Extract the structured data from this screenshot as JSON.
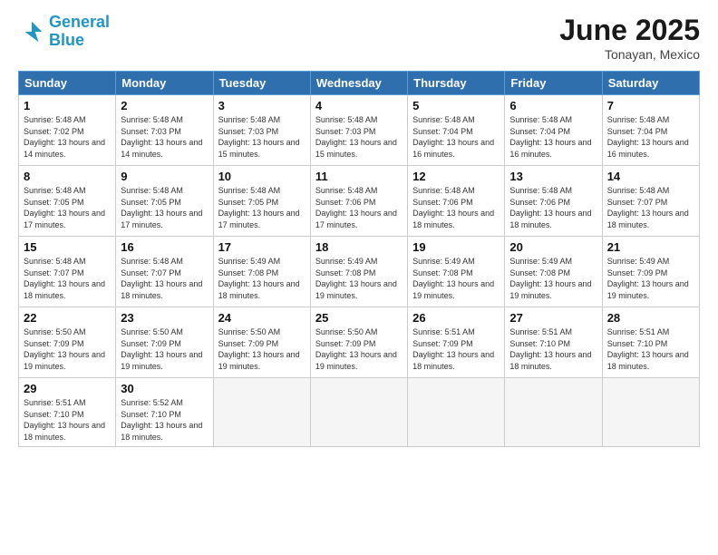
{
  "logo": {
    "line1": "General",
    "line2": "Blue"
  },
  "title": "June 2025",
  "subtitle": "Tonayan, Mexico",
  "weekdays": [
    "Sunday",
    "Monday",
    "Tuesday",
    "Wednesday",
    "Thursday",
    "Friday",
    "Saturday"
  ],
  "days": [
    {
      "num": "",
      "info": ""
    },
    {
      "num": "",
      "info": ""
    },
    {
      "num": "",
      "info": ""
    },
    {
      "num": "",
      "info": ""
    },
    {
      "num": "",
      "info": ""
    },
    {
      "num": "",
      "info": ""
    },
    {
      "num": "",
      "info": ""
    },
    {
      "num": "1",
      "sunrise": "Sunrise: 5:48 AM",
      "sunset": "Sunset: 7:02 PM",
      "daylight": "Daylight: 13 hours and 14 minutes."
    },
    {
      "num": "2",
      "sunrise": "Sunrise: 5:48 AM",
      "sunset": "Sunset: 7:03 PM",
      "daylight": "Daylight: 13 hours and 14 minutes."
    },
    {
      "num": "3",
      "sunrise": "Sunrise: 5:48 AM",
      "sunset": "Sunset: 7:03 PM",
      "daylight": "Daylight: 13 hours and 15 minutes."
    },
    {
      "num": "4",
      "sunrise": "Sunrise: 5:48 AM",
      "sunset": "Sunset: 7:03 PM",
      "daylight": "Daylight: 13 hours and 15 minutes."
    },
    {
      "num": "5",
      "sunrise": "Sunrise: 5:48 AM",
      "sunset": "Sunset: 7:04 PM",
      "daylight": "Daylight: 13 hours and 16 minutes."
    },
    {
      "num": "6",
      "sunrise": "Sunrise: 5:48 AM",
      "sunset": "Sunset: 7:04 PM",
      "daylight": "Daylight: 13 hours and 16 minutes."
    },
    {
      "num": "7",
      "sunrise": "Sunrise: 5:48 AM",
      "sunset": "Sunset: 7:04 PM",
      "daylight": "Daylight: 13 hours and 16 minutes."
    },
    {
      "num": "8",
      "sunrise": "Sunrise: 5:48 AM",
      "sunset": "Sunset: 7:05 PM",
      "daylight": "Daylight: 13 hours and 17 minutes."
    },
    {
      "num": "9",
      "sunrise": "Sunrise: 5:48 AM",
      "sunset": "Sunset: 7:05 PM",
      "daylight": "Daylight: 13 hours and 17 minutes."
    },
    {
      "num": "10",
      "sunrise": "Sunrise: 5:48 AM",
      "sunset": "Sunset: 7:05 PM",
      "daylight": "Daylight: 13 hours and 17 minutes."
    },
    {
      "num": "11",
      "sunrise": "Sunrise: 5:48 AM",
      "sunset": "Sunset: 7:06 PM",
      "daylight": "Daylight: 13 hours and 17 minutes."
    },
    {
      "num": "12",
      "sunrise": "Sunrise: 5:48 AM",
      "sunset": "Sunset: 7:06 PM",
      "daylight": "Daylight: 13 hours and 18 minutes."
    },
    {
      "num": "13",
      "sunrise": "Sunrise: 5:48 AM",
      "sunset": "Sunset: 7:06 PM",
      "daylight": "Daylight: 13 hours and 18 minutes."
    },
    {
      "num": "14",
      "sunrise": "Sunrise: 5:48 AM",
      "sunset": "Sunset: 7:07 PM",
      "daylight": "Daylight: 13 hours and 18 minutes."
    },
    {
      "num": "15",
      "sunrise": "Sunrise: 5:48 AM",
      "sunset": "Sunset: 7:07 PM",
      "daylight": "Daylight: 13 hours and 18 minutes."
    },
    {
      "num": "16",
      "sunrise": "Sunrise: 5:48 AM",
      "sunset": "Sunset: 7:07 PM",
      "daylight": "Daylight: 13 hours and 18 minutes."
    },
    {
      "num": "17",
      "sunrise": "Sunrise: 5:49 AM",
      "sunset": "Sunset: 7:08 PM",
      "daylight": "Daylight: 13 hours and 18 minutes."
    },
    {
      "num": "18",
      "sunrise": "Sunrise: 5:49 AM",
      "sunset": "Sunset: 7:08 PM",
      "daylight": "Daylight: 13 hours and 19 minutes."
    },
    {
      "num": "19",
      "sunrise": "Sunrise: 5:49 AM",
      "sunset": "Sunset: 7:08 PM",
      "daylight": "Daylight: 13 hours and 19 minutes."
    },
    {
      "num": "20",
      "sunrise": "Sunrise: 5:49 AM",
      "sunset": "Sunset: 7:08 PM",
      "daylight": "Daylight: 13 hours and 19 minutes."
    },
    {
      "num": "21",
      "sunrise": "Sunrise: 5:49 AM",
      "sunset": "Sunset: 7:09 PM",
      "daylight": "Daylight: 13 hours and 19 minutes."
    },
    {
      "num": "22",
      "sunrise": "Sunrise: 5:50 AM",
      "sunset": "Sunset: 7:09 PM",
      "daylight": "Daylight: 13 hours and 19 minutes."
    },
    {
      "num": "23",
      "sunrise": "Sunrise: 5:50 AM",
      "sunset": "Sunset: 7:09 PM",
      "daylight": "Daylight: 13 hours and 19 minutes."
    },
    {
      "num": "24",
      "sunrise": "Sunrise: 5:50 AM",
      "sunset": "Sunset: 7:09 PM",
      "daylight": "Daylight: 13 hours and 19 minutes."
    },
    {
      "num": "25",
      "sunrise": "Sunrise: 5:50 AM",
      "sunset": "Sunset: 7:09 PM",
      "daylight": "Daylight: 13 hours and 19 minutes."
    },
    {
      "num": "26",
      "sunrise": "Sunrise: 5:51 AM",
      "sunset": "Sunset: 7:09 PM",
      "daylight": "Daylight: 13 hours and 18 minutes."
    },
    {
      "num": "27",
      "sunrise": "Sunrise: 5:51 AM",
      "sunset": "Sunset: 7:10 PM",
      "daylight": "Daylight: 13 hours and 18 minutes."
    },
    {
      "num": "28",
      "sunrise": "Sunrise: 5:51 AM",
      "sunset": "Sunset: 7:10 PM",
      "daylight": "Daylight: 13 hours and 18 minutes."
    },
    {
      "num": "29",
      "sunrise": "Sunrise: 5:51 AM",
      "sunset": "Sunset: 7:10 PM",
      "daylight": "Daylight: 13 hours and 18 minutes."
    },
    {
      "num": "30",
      "sunrise": "Sunrise: 5:52 AM",
      "sunset": "Sunset: 7:10 PM",
      "daylight": "Daylight: 13 hours and 18 minutes."
    },
    {
      "num": "",
      "info": ""
    },
    {
      "num": "",
      "info": ""
    },
    {
      "num": "",
      "info": ""
    },
    {
      "num": "",
      "info": ""
    },
    {
      "num": "",
      "info": ""
    }
  ]
}
